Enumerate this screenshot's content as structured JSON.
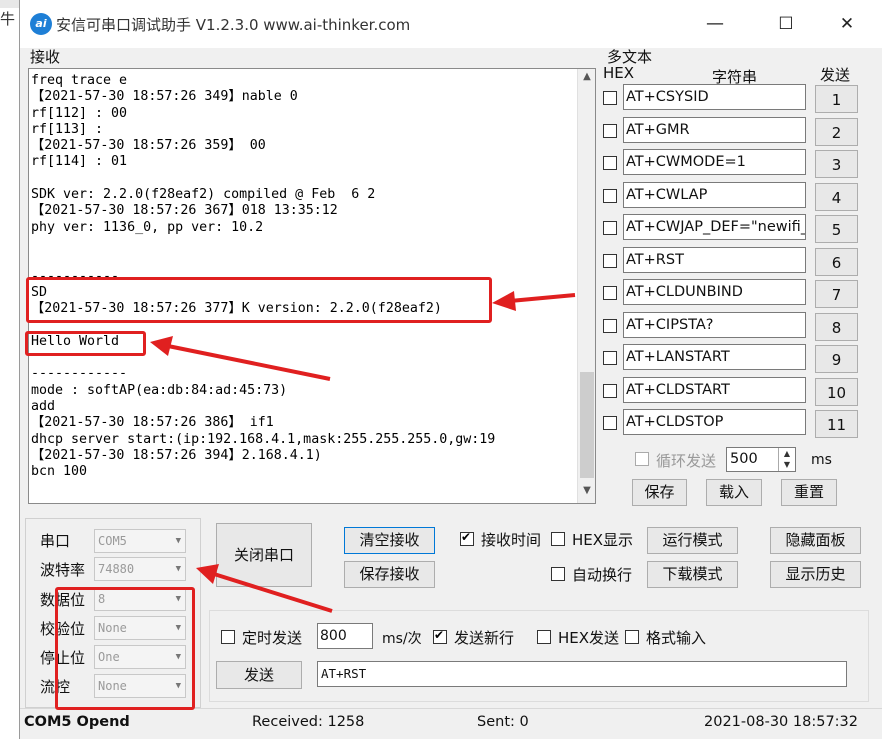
{
  "window": {
    "title": "安信可串口调试助手 V1.2.3.0    www.ai-thinker.com",
    "icon_text": "ai",
    "minimize_glyph": "—",
    "maximize_glyph": "☐",
    "close_glyph": "✕"
  },
  "left_edge_char": "牛",
  "receive": {
    "label": "接收",
    "lines": [
      "freq trace e",
      "【2021-57-30 18:57:26 349】nable 0",
      "rf[112] : 00",
      "rf[113] :",
      "【2021-57-30 18:57:26 359】 00",
      "rf[114] : 01",
      "",
      "SDK ver: 2.2.0(f28eaf2) compiled @ Feb  6 2",
      "【2021-57-30 18:57:26 367】018 13:35:12",
      "phy ver: 1136_0, pp ver: 10.2",
      "",
      "",
      "-----------",
      "SD",
      "【2021-57-30 18:57:26 377】K version: 2.2.0(f28eaf2)",
      "",
      "Hello World",
      "",
      "------------",
      "mode : softAP(ea:db:84:ad:45:73)",
      "add",
      "【2021-57-30 18:57:26 386】 if1",
      "dhcp server start:(ip:192.168.4.1,mask:255.255.255.0,gw:19",
      "【2021-57-30 18:57:26 394】2.168.4.1)",
      "bcn 100"
    ],
    "scroll_up": "▲",
    "scroll_down": "▼"
  },
  "multi_text": {
    "title": "多文本",
    "hex_header": "HEX",
    "string_header": "字符串",
    "send_header": "发送",
    "rows": [
      {
        "text": "AT+CSYSID",
        "button": "1",
        "hex": false
      },
      {
        "text": "AT+GMR",
        "button": "2",
        "hex": false
      },
      {
        "text": "AT+CWMODE=1",
        "button": "3",
        "hex": false
      },
      {
        "text": "AT+CWLAP",
        "button": "4",
        "hex": false
      },
      {
        "text": "AT+CWJAP_DEF=\"newifi_",
        "button": "5",
        "hex": false
      },
      {
        "text": "AT+RST",
        "button": "6",
        "hex": false
      },
      {
        "text": "AT+CLDUNBIND",
        "button": "7",
        "hex": false
      },
      {
        "text": "AT+CIPSTA?",
        "button": "8",
        "hex": false
      },
      {
        "text": "AT+LANSTART",
        "button": "9",
        "hex": false
      },
      {
        "text": "AT+CLDSTART",
        "button": "10",
        "hex": false
      },
      {
        "text": "AT+CLDSTOP",
        "button": "11",
        "hex": false
      }
    ],
    "loop_send_label": "循环发送",
    "loop_interval": "500",
    "loop_unit": "ms",
    "spin_up": "▲",
    "spin_down": "▼",
    "save_button": "保存",
    "load_button": "载入",
    "reset_button": "重置"
  },
  "serial_settings": {
    "port_label": "串口",
    "port_value": "COM5",
    "baud_label": "波特率",
    "baud_value": "74880",
    "databits_label": "数据位",
    "databits_value": "8",
    "parity_label": "校验位",
    "parity_value": "None",
    "stopbits_label": "停止位",
    "stopbits_value": "One",
    "flow_label": "流控",
    "flow_value": "None",
    "arrow": "▼"
  },
  "controls": {
    "close_port_button": "关闭串口",
    "clear_receive_button": "清空接收",
    "save_receive_button": "保存接收",
    "receive_time_label": "接收时间",
    "receive_time_checked": true,
    "hex_display_label": "HEX显示",
    "auto_wrap_label": "自动换行",
    "run_mode_button": "运行模式",
    "download_mode_button": "下载模式",
    "hide_panel_button": "隐藏面板",
    "show_history_button": "显示历史"
  },
  "send": {
    "timed_send_label": "定时发送",
    "interval_value": "800",
    "interval_unit": "ms/次",
    "send_newline_label": "发送新行",
    "send_newline_checked": true,
    "hex_send_label": "HEX发送",
    "format_input_label": "格式输入",
    "send_button": "发送",
    "send_text": "AT+RST"
  },
  "status": {
    "port_status": "COM5 Opend",
    "received": "Received: 1258",
    "sent": "Sent: 0",
    "datetime": "2021-08-30 18:57:32"
  },
  "colors": {
    "annotation_red": "#e02020",
    "window_bg": "#f0f0f0",
    "icon_blue": "#1e7fd6"
  }
}
